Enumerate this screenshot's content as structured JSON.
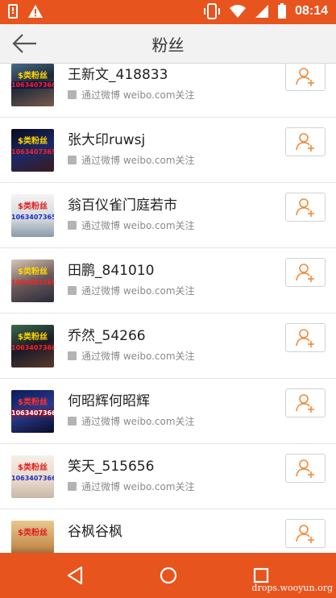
{
  "status_bar": {
    "time": "08:14",
    "icons": [
      "sd-card-icon",
      "warning-icon",
      "vibrate-icon",
      "wifi-icon",
      "signal-icon",
      "battery-icon"
    ],
    "color": "#e8541e"
  },
  "header": {
    "title": "粉丝",
    "back_icon": "back-arrow-icon"
  },
  "followers": [
    {
      "name": "王新文_418833",
      "source": "通过微博 weibo.com关注",
      "avatar_text": [
        "$类粉丝",
        "10634073662"
      ]
    },
    {
      "name": "张大印ruwsj",
      "source": "通过微博 weibo.com关注",
      "avatar_text": [
        "$类粉丝",
        "10634073654"
      ]
    },
    {
      "name": "翁百仪雀门庭若市",
      "source": "通过微博 weibo.com关注",
      "avatar_text": [
        "$类粉丝",
        "10634073654"
      ]
    },
    {
      "name": "田鹏_841010",
      "source": "通过微博 weibo.com关注",
      "avatar_text": [
        "$类粉丝",
        "10634073662"
      ]
    },
    {
      "name": "乔然_54266",
      "source": "通过微博 weibo.com关注",
      "avatar_text": [
        "$类粉丝",
        "10634073662"
      ]
    },
    {
      "name": "何昭辉何昭辉",
      "source": "通过微博 weibo.com关注",
      "avatar_text": [
        "$类粉丝",
        "10634073662"
      ]
    },
    {
      "name": "笑天_515656",
      "source": "通过微博 weibo.com关注",
      "avatar_text": [
        "$类粉丝",
        "10634073662"
      ]
    },
    {
      "name": "谷枫谷枫",
      "source": "",
      "avatar_text": [
        "$类粉丝",
        ""
      ]
    }
  ],
  "nav_bar": {
    "buttons": [
      "back-triangle-icon",
      "home-circle-icon",
      "recents-square-icon"
    ]
  },
  "watermark": "drops.wooyun.org",
  "colors": {
    "accent": "#e8541e",
    "follow_icon": "#f08a3c"
  }
}
